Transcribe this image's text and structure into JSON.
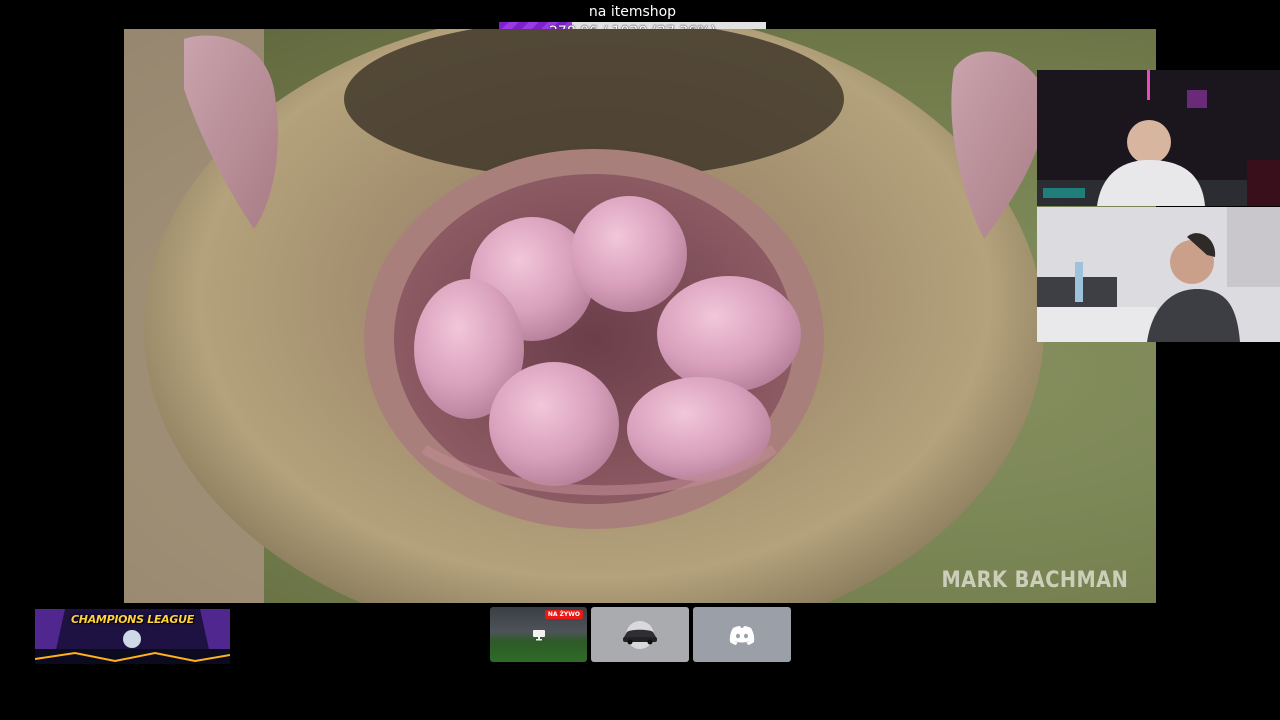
{
  "goal": {
    "title": "na itemshop",
    "progress_text": "278.06 / 1020 (27.26%)",
    "current": 278.06,
    "target": 1020,
    "percent": 27.26,
    "fill_color": "#8a2be2"
  },
  "main_video": {
    "watermark": "MARK BACHMAN"
  },
  "banner": {
    "text": "CHAMPIONS LEAGUE"
  },
  "thumbnails": {
    "live_badge": "NA ŻYWO",
    "live_icon": "monitor-icon",
    "car_icon": "car-icon",
    "discord_icon": "discord-icon"
  }
}
